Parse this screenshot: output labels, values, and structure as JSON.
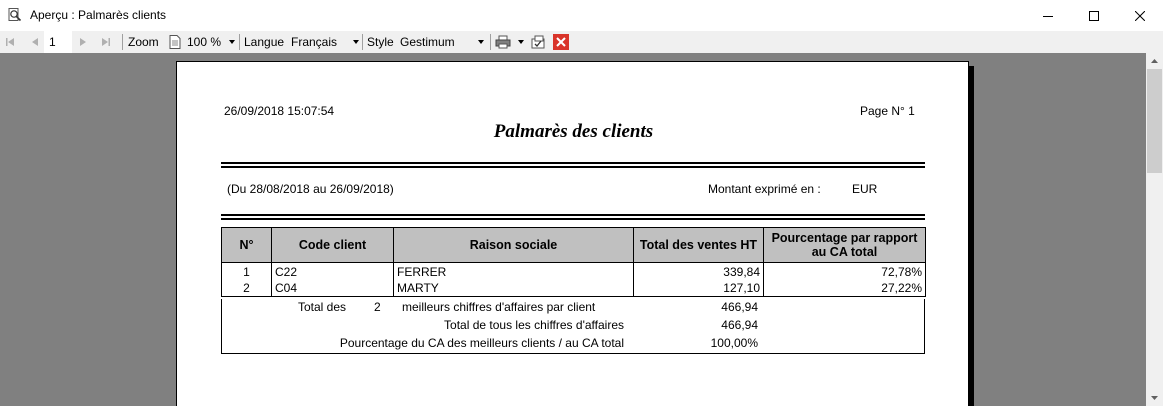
{
  "window": {
    "title": "Aperçu : Palmarès clients"
  },
  "toolbar": {
    "page_number": "1",
    "zoom_label": "Zoom",
    "zoom_value": "100 %",
    "language_label": "Langue",
    "language_value": "Français",
    "style_label": "Style",
    "style_value": "Gestimum"
  },
  "report": {
    "datetime": "26/09/2018 15:07:54",
    "page": "Page N° 1",
    "title": "Palmarès des clients",
    "period": "(Du 28/08/2018 au 26/09/2018)",
    "amount_label": "Montant exprimé en :",
    "currency": "EUR",
    "columns": [
      "N°",
      "Code client",
      "Raison sociale",
      "Total des ventes HT",
      "Pourcentage par rapport au CA total"
    ],
    "rows": [
      {
        "num": "1",
        "code": "C22",
        "name": "FERRER",
        "total": "339,84",
        "pct": "72,78%"
      },
      {
        "num": "2",
        "code": "C04",
        "name": "MARTY",
        "total": "127,10",
        "pct": "27,22%"
      }
    ],
    "totals": {
      "best_prefix": "Total des",
      "best_count": "2",
      "best_suffix": "meilleurs chiffres d'affaires par client",
      "best_value": "466,94",
      "all_label": "Total de tous les chiffres d'affaires",
      "all_value": "466,94",
      "pct_label": "Pourcentage du CA des meilleurs clients / au CA total",
      "pct_value": "100,00%"
    }
  }
}
